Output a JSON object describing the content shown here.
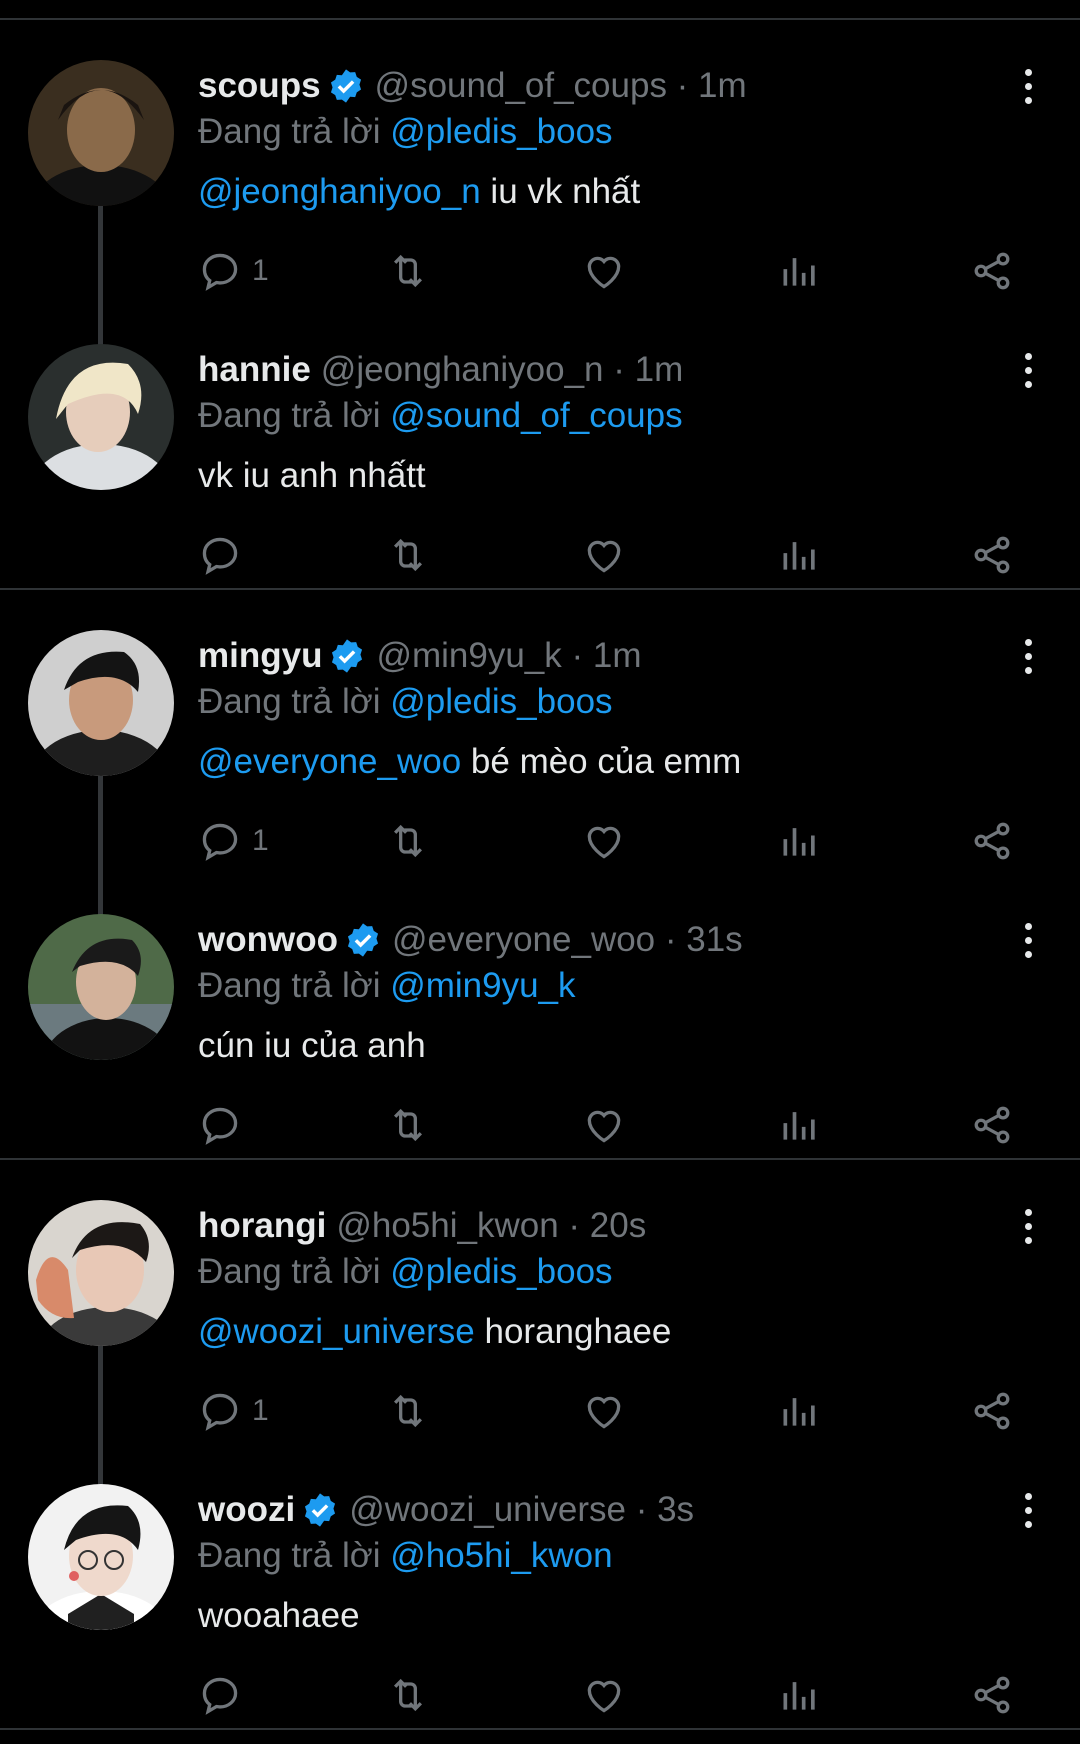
{
  "replying_prefix": "Đang trả lời",
  "icons": [
    "reply-icon",
    "retweet-icon",
    "like-icon",
    "views-icon",
    "share-icon",
    "more-icon",
    "verified-icon"
  ],
  "colors": {
    "background": "#000000",
    "link": "#1d9bf0",
    "muted": "#71767b",
    "text": "#e7e9ea",
    "verified": "#1d9bf0",
    "divider": "#2f3336"
  },
  "threads": [
    {
      "tweets": [
        {
          "name": "scoups",
          "verified": true,
          "handle": "@sound_of_coups · 1m",
          "replying_to": "@pledis_boos",
          "mention": "@jeonghaniyoo_n",
          "text": " iu vk nhất",
          "reply_count": "1"
        },
        {
          "name": "hannie",
          "verified": false,
          "handle": "@jeonghaniyoo_n · 1m",
          "replying_to": "@sound_of_coups",
          "mention": "",
          "text": "vk iu anh nhấtt",
          "reply_count": ""
        }
      ]
    },
    {
      "tweets": [
        {
          "name": "mingyu",
          "verified": true,
          "handle": "@min9yu_k · 1m",
          "replying_to": "@pledis_boos",
          "mention": "@everyone_woo",
          "text": " bé mèo của emm",
          "reply_count": "1"
        },
        {
          "name": "wonwoo",
          "verified": true,
          "handle": "@everyone_woo · 31s",
          "replying_to": "@min9yu_k",
          "mention": "",
          "text": "cún iu của anh",
          "reply_count": ""
        }
      ]
    },
    {
      "tweets": [
        {
          "name": "horangi",
          "verified": false,
          "handle": "@ho5hi_kwon · 20s",
          "replying_to": "@pledis_boos",
          "mention": "@woozi_universe",
          "text": " horanghaee",
          "reply_count": "1"
        },
        {
          "name": "woozi",
          "verified": true,
          "handle": "@woozi_universe · 3s",
          "replying_to": "@ho5hi_kwon",
          "mention": "",
          "text": "wooahaee",
          "reply_count": ""
        }
      ]
    }
  ]
}
